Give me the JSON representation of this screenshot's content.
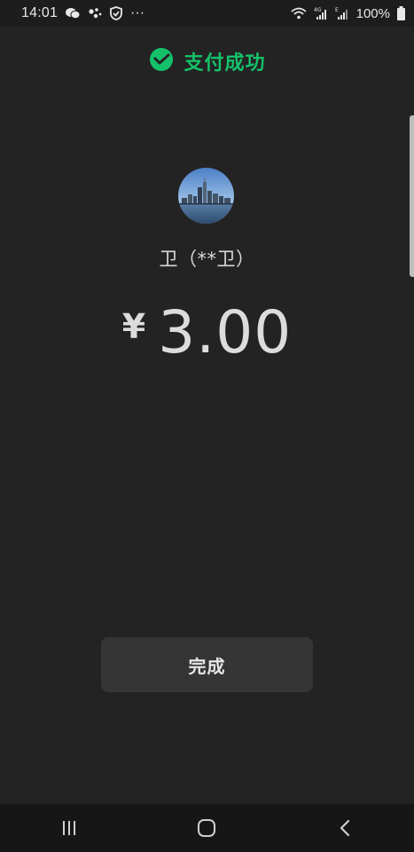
{
  "status_bar": {
    "time": "14:01",
    "more": "···",
    "battery": "100%"
  },
  "header": {
    "title": "支付成功",
    "accent_color": "#14c16a"
  },
  "payee": {
    "name": "卫（**卫）"
  },
  "payment": {
    "currency_symbol": "¥",
    "amount": "3.00"
  },
  "actions": {
    "done_label": "完成"
  },
  "nav_bar": {
    "items": [
      "recents",
      "home",
      "back"
    ]
  }
}
